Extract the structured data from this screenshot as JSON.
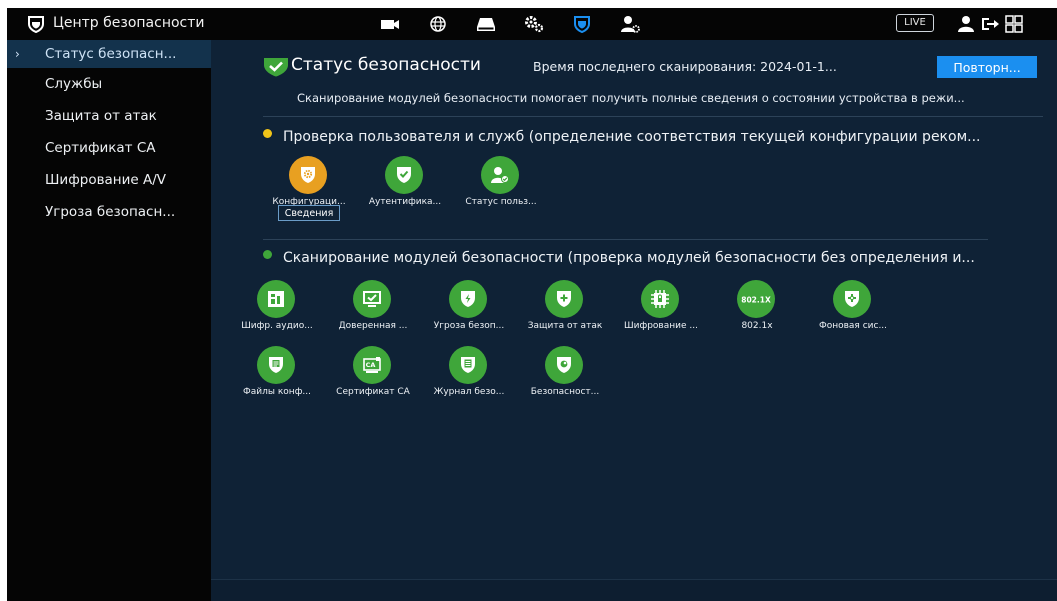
{
  "header": {
    "app_title": "Центр безопасности",
    "live_label": "LIVE"
  },
  "sidebar": {
    "items": [
      {
        "label": "Статус безопасн...",
        "active": true
      },
      {
        "label": "Службы"
      },
      {
        "label": "Защита от атак"
      },
      {
        "label": "Сертификат CA"
      },
      {
        "label": "Шифрование A/V"
      },
      {
        "label": "Угроза безопасн..."
      }
    ]
  },
  "main": {
    "title": "Статус безопасности",
    "last_scan": "Время последнего сканирования: 2024-01-1...",
    "rescan_label": "Повторн...",
    "description": "Сканирование модулей безопасности помогает получить полные сведения о состоянии устройства в режи...",
    "section1": {
      "title": "Проверка пользователя и служб (определение соответствия текущей конфигурации реком...",
      "status_color": "#f0c419",
      "tiles": [
        {
          "label": "Конфигураци...",
          "color": "orange",
          "icon": "config-shield-icon"
        },
        {
          "label": "Аутентифика...",
          "color": "green",
          "icon": "shield-check-icon"
        },
        {
          "label": "Статус польз...",
          "color": "green",
          "icon": "user-status-icon"
        }
      ],
      "details_label": "Сведения"
    },
    "section2": {
      "title": "Сканирование модулей безопасности (проверка модулей безопасности без определения и...",
      "status_color": "#3fa63a",
      "tiles": [
        {
          "label": "Шифр. аудио...",
          "icon": "audio-encrypt-icon"
        },
        {
          "label": "Доверенная ...",
          "icon": "trusted-monitor-icon"
        },
        {
          "label": "Угроза безоп...",
          "icon": "threat-shield-icon"
        },
        {
          "label": "Защита от атак",
          "icon": "attack-shield-icon"
        },
        {
          "label": "Шифрование ...",
          "icon": "chip-icon"
        },
        {
          "label": "802.1x",
          "icon": "802-1x-icon",
          "badge": "802.1X"
        },
        {
          "label": "Фоновая сис...",
          "icon": "background-shield-icon"
        },
        {
          "label": "Файлы конф...",
          "icon": "config-file-icon"
        },
        {
          "label": "Сертификат CA",
          "icon": "ca-cert-icon",
          "badge": "CA"
        },
        {
          "label": "Журнал безо...",
          "icon": "log-icon"
        },
        {
          "label": "Безопасност...",
          "icon": "security-shield-icon"
        }
      ]
    }
  },
  "colors": {
    "accent": "#1b8ff0",
    "ok": "#3fa63a",
    "warn": "#e8a021",
    "background": "#0f2236",
    "bar": "#050505"
  }
}
